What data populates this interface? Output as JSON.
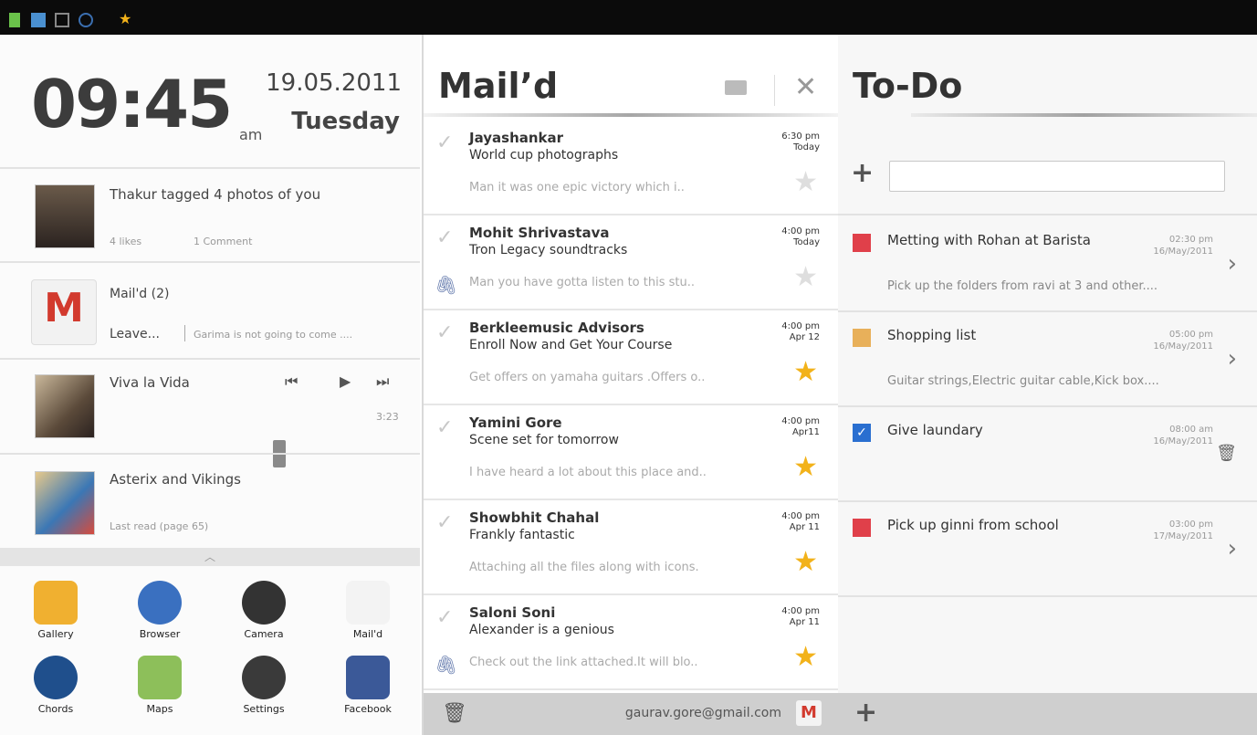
{
  "statusbar": {
    "icons": [
      "battery-icon",
      "sd-card-icon",
      "usb-icon",
      "sync-icon",
      "star-icon"
    ]
  },
  "left": {
    "time": "09:45",
    "ampm": "am",
    "date": "19.05.2011",
    "day": "Tuesday",
    "social": {
      "title": "Thakur tagged 4 photos of you",
      "likes": "4 likes",
      "comments": "1 Comment"
    },
    "mail": {
      "title": "Mail'd  (2)",
      "from": "Leave...",
      "preview": "Garima is not going to come ...."
    },
    "music": {
      "title": "Viva la Vida",
      "time": "3:23",
      "progress": 0.67
    },
    "book": {
      "title": "Asterix and Vikings",
      "sub": "Last read (page 65)"
    },
    "apps": [
      {
        "label": "Gallery",
        "icon": "gallery-icon"
      },
      {
        "label": "Browser",
        "icon": "browser-icon"
      },
      {
        "label": "Camera",
        "icon": "camera-icon"
      },
      {
        "label": "Mail'd",
        "icon": "mail-icon"
      },
      {
        "label": "Chords",
        "icon": "chords-icon"
      },
      {
        "label": "Maps",
        "icon": "maps-icon"
      },
      {
        "label": "Settings",
        "icon": "settings-icon"
      },
      {
        "label": "Facebook",
        "icon": "facebook-icon"
      }
    ]
  },
  "mail": {
    "title": "Mail’d",
    "account": "gaurav.gore@gmail.com",
    "items": [
      {
        "sender": "Jayashankar",
        "subject": "World cup photographs",
        "snippet": "Man it was one epic victory which i..",
        "time": "6:30 pm",
        "when": "Today",
        "starred": false,
        "attachment": false
      },
      {
        "sender": "Mohit Shrivastava",
        "subject": "Tron Legacy soundtracks",
        "snippet": "Man you have gotta listen to this stu..",
        "time": "4:00 pm",
        "when": "Today",
        "starred": false,
        "attachment": true
      },
      {
        "sender": "Berkleemusic Advisors",
        "subject": "Enroll Now and Get Your Course",
        "snippet": "Get offers on yamaha guitars .Offers o..",
        "time": "4:00 pm",
        "when": "Apr 12",
        "starred": true,
        "attachment": false
      },
      {
        "sender": "Yamini Gore",
        "subject": "Scene set for tomorrow",
        "snippet": "I have heard a lot about this place and..",
        "time": "4:00 pm",
        "when": "Apr11",
        "starred": true,
        "attachment": false
      },
      {
        "sender": "Showbhit Chahal",
        "subject": "Frankly fantastic",
        "snippet": "Attaching all the files along with icons.",
        "time": "4:00 pm",
        "when": "Apr 11",
        "starred": true,
        "attachment": false
      },
      {
        "sender": "Saloni Soni",
        "subject": "Alexander is a genious",
        "snippet": "Check out the link attached.It will blo..",
        "time": "4:00 pm",
        "when": "Apr 11",
        "starred": true,
        "attachment": true
      }
    ]
  },
  "todo": {
    "title": "To-Do",
    "input_placeholder": "",
    "items": [
      {
        "title": "Metting with Rohan at Barista",
        "time": "02:30 pm",
        "date": "16/May/2011",
        "desc": "Pick up the folders from ravi  at 3 and other....",
        "color": "#e0404a",
        "done": false
      },
      {
        "title": "Shopping list",
        "time": "05:00 pm",
        "date": "16/May/2011",
        "desc": "Guitar strings,Electric guitar cable,Kick box....",
        "color": "#e8b05a",
        "done": false
      },
      {
        "title": "Give laundary",
        "time": "08:00 am",
        "date": "16/May/2011",
        "desc": "",
        "color": "#2a6fd0",
        "done": true
      },
      {
        "title": "Pick up ginni from school",
        "time": "03:00 pm",
        "date": "17/May/2011",
        "desc": "",
        "color": "#e0404a",
        "done": false
      }
    ]
  }
}
